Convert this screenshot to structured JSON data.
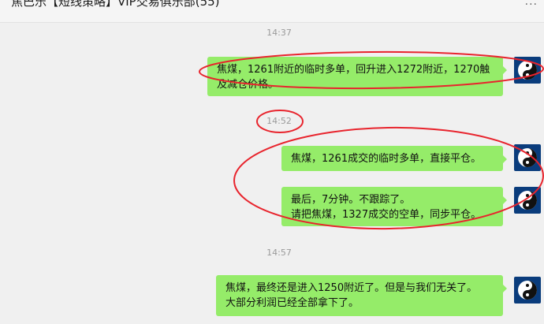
{
  "header": {
    "title": "焦巴乐【短线策略】VIP交易俱乐部(55)",
    "more_label": "···"
  },
  "messages": [
    {
      "time": "14:37",
      "text": "焦煤，1261附近的临时多单，回升进入1272附近，1270触及减仓价格。"
    },
    {
      "time": "14:52",
      "text": "焦煤，1261成交的临时多单，直接平仓。"
    },
    {
      "text": "最后，7分钟。不跟踪了。\n请把焦煤，1327成交的空单，同步平仓。"
    },
    {
      "time": "14:57",
      "text": "焦煤，最终还是进入1250附近了。但是与我们无关了。\n大部分利润已经全部拿下了。"
    }
  ],
  "colors": {
    "bubble": "#95ec69",
    "annotation": "#e8242d",
    "avatar": "#0a3c7c"
  },
  "avatar_icon": "yin-yang-icon"
}
